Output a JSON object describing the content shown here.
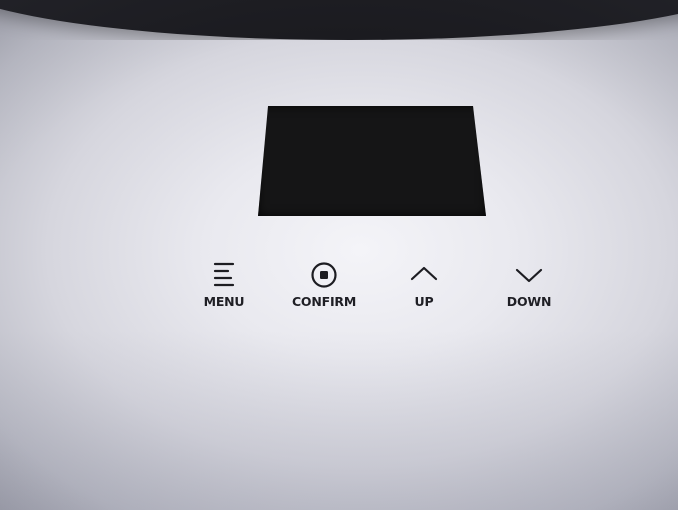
{
  "device_panel": {
    "buttons": [
      {
        "id": "menu",
        "label": "MENU",
        "icon": "hamburger-menu-icon"
      },
      {
        "id": "confirm",
        "label": "CONFIRM",
        "icon": "circle-dot-icon"
      },
      {
        "id": "up",
        "label": "UP",
        "icon": "chevron-up-icon"
      },
      {
        "id": "down",
        "label": "DOWN",
        "icon": "chevron-down-icon"
      }
    ]
  },
  "colors": {
    "panel_surface": "#e9e9ef",
    "lcd_screen": "#151516",
    "print_ink": "#1d1d22",
    "housing_edge": "#1b1b20"
  }
}
